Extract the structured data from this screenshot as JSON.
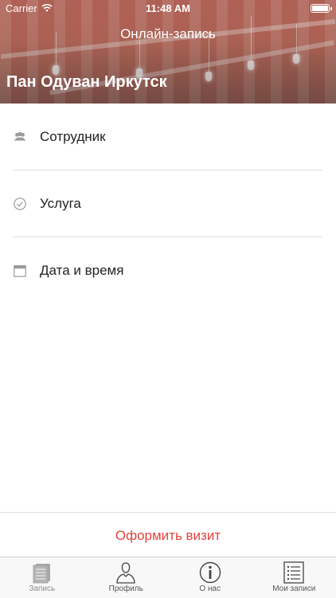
{
  "status_bar": {
    "carrier": "Carrier",
    "time": "11:48 AM",
    "battery_level": 1.0
  },
  "header": {
    "title": "Онлайн-запись",
    "business_name": "Пан Одуван Иркутск"
  },
  "booking_fields": [
    {
      "label": "Сотрудник",
      "icon": "people-icon"
    },
    {
      "label": "Услуга",
      "icon": "checkmark-circle-icon"
    },
    {
      "label": "Дата и время",
      "icon": "calendar-icon"
    }
  ],
  "action": {
    "label": "Оформить визит",
    "color": "#e3413b"
  },
  "tabs": [
    {
      "label": "Запись",
      "icon": "document-icon",
      "active": true
    },
    {
      "label": "Профиль",
      "icon": "user-icon",
      "active": false
    },
    {
      "label": "О нас",
      "icon": "info-icon",
      "active": false
    },
    {
      "label": "Мои записи",
      "icon": "list-icon",
      "active": false
    }
  ]
}
